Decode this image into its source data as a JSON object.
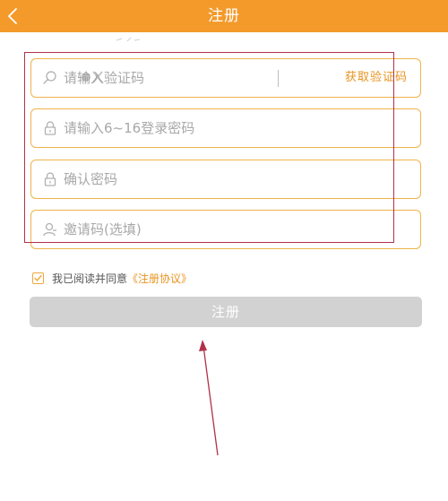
{
  "header": {
    "title": "注册",
    "back_icon": "chevron-left-icon"
  },
  "form": {
    "code": {
      "placeholder": "请输入验证码",
      "icon": "search-icon",
      "get_code_label": "获取验证码"
    },
    "password": {
      "placeholder": "请输入6~16登录密码",
      "icon": "lock-icon"
    },
    "confirm": {
      "placeholder": "确认密码",
      "icon": "lock-icon"
    },
    "invite": {
      "placeholder": "邀请码(选填)",
      "icon": "user-icon"
    }
  },
  "agreement": {
    "checked": true,
    "text": "我已阅读并同意",
    "link": "《注册协议》"
  },
  "submit": {
    "label": "注册"
  },
  "colors": {
    "header": "#f39a2b",
    "field_border": "#efb34a",
    "accent_text": "#e8931f",
    "button_disabled": "#d2d2d2",
    "annotation": "#b0324a"
  }
}
